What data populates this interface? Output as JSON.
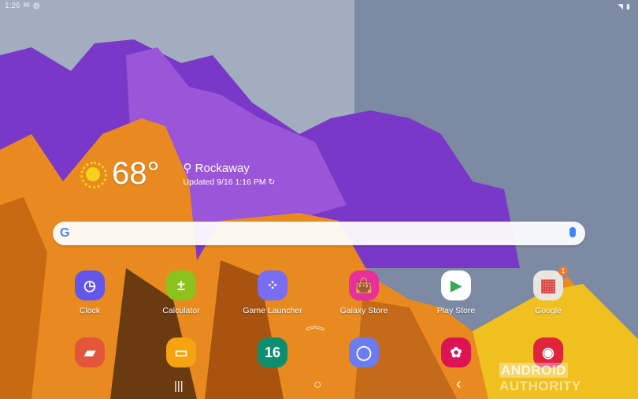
{
  "status": {
    "time": "1:26",
    "left_icons": [
      "mail-icon",
      "messenger-icon"
    ],
    "right_icons": [
      "wifi-icon",
      "battery-icon"
    ]
  },
  "weather": {
    "temp": "68°",
    "location": "Rockaway",
    "updated": "Updated 9/16 1:16 PM",
    "icon": "sunny-icon"
  },
  "search": {
    "logo": "G",
    "mic": "mic-icon"
  },
  "apps_row1": [
    {
      "label": "Clock",
      "color": "#6257e8",
      "glyph": "◷"
    },
    {
      "label": "Calculator",
      "color": "#8cc21e",
      "glyph": "±"
    },
    {
      "label": "Game Launcher",
      "color": "#7a6ef0",
      "glyph": "⁘"
    },
    {
      "label": "Galaxy Store",
      "color": "#e8309a",
      "glyph": "👜"
    },
    {
      "label": "Play Store",
      "color": "#ffffff",
      "glyph": "▶"
    },
    {
      "label": "Google",
      "color": "#e9e6e0",
      "glyph": "▦",
      "badge": "1"
    }
  ],
  "apps_row2": [
    {
      "name": "notes",
      "color": "#e5553a",
      "glyph": "▰"
    },
    {
      "name": "my-files",
      "color": "#f6a311",
      "glyph": "▭"
    },
    {
      "name": "calendar",
      "color": "#0d8f6e",
      "glyph": "16"
    },
    {
      "name": "internet",
      "color": "#6b7cf0",
      "glyph": "◯"
    },
    {
      "name": "gallery",
      "color": "#dc1454",
      "glyph": "✿"
    },
    {
      "name": "camera",
      "color": "#e0243e",
      "glyph": "◉"
    }
  ],
  "nav": {
    "recents": "|||",
    "home": "○",
    "back": "‹"
  },
  "watermark": {
    "a": "ANDROID",
    "b": "AUTHORITY"
  }
}
